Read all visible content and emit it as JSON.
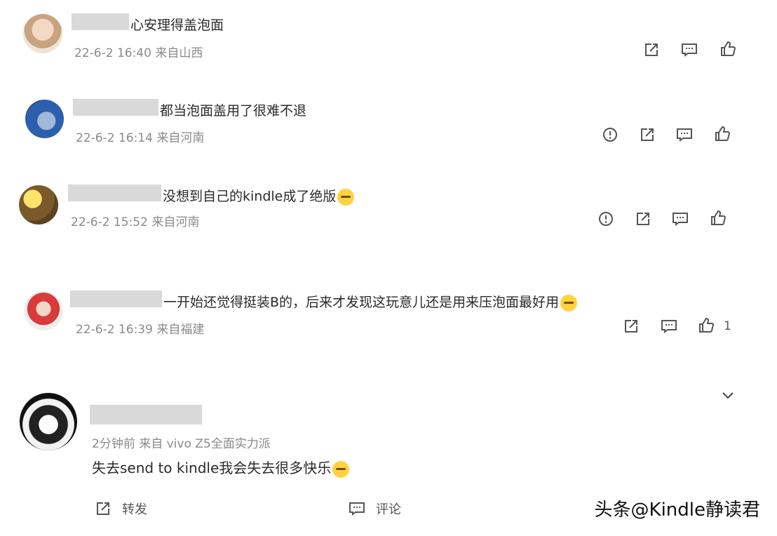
{
  "comments": [
    {
      "text": "心安理得盖泡面",
      "meta": "22-6-2 16:40 来自山西"
    },
    {
      "text": "都当泡面盖用了很难不退",
      "meta": "22-6-2 16:14 来自河南"
    },
    {
      "text": "没想到自己的kindle成了绝版",
      "meta": "22-6-2 15:52 来自河南"
    },
    {
      "text": "一开始还觉得挺装B的，后来才发现这玩意儿还是用来压泡面最好用",
      "meta": "22-6-2 16:39 来自福建",
      "like_count": "1"
    },
    {
      "text": "失去send to kindle我会失去很多快乐",
      "meta": "2分钟前  来自 vivo Z5全面实力派"
    }
  ],
  "actions": {
    "repost": "转发",
    "comment": "评论"
  },
  "watermark": "头条@Kindle静读君",
  "colors": {
    "meta": "#8a8a8a",
    "icon": "#555555",
    "redact": "#d9d9d9"
  }
}
